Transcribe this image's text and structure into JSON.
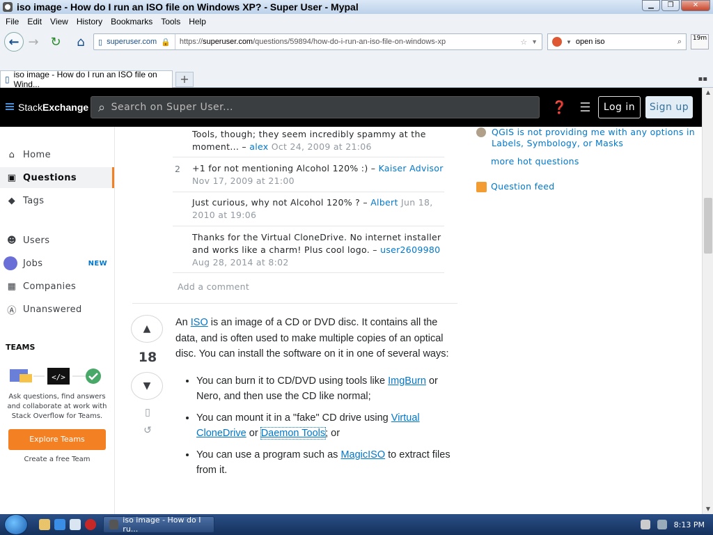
{
  "window": {
    "title": "iso image - How do I run an ISO file on Windows XP? - Super User - Mypal"
  },
  "menu": [
    "File",
    "Edit",
    "View",
    "History",
    "Bookmarks",
    "Tools",
    "Help"
  ],
  "addressbar": {
    "identity": "superuser.com",
    "url_prefix": "https://",
    "url_host": "superuser.com",
    "url_path": "/questions/59894/how-do-i-run-an-iso-file-on-windows-xp"
  },
  "searchbar": {
    "value": "open iso"
  },
  "timebox": {
    "value": "19m"
  },
  "tab": {
    "label": "iso image - How do I run an ISO file on Wind..."
  },
  "site": {
    "logo_prefix": "Stack",
    "logo_suffix": "Exchange",
    "search_placeholder": "Search on Super User...",
    "login": "Log in",
    "signup": "Sign up"
  },
  "sidebar": {
    "items": [
      {
        "label": "Home",
        "icon": "home-icon"
      },
      {
        "label": "Questions",
        "icon": "questions-icon"
      },
      {
        "label": "Tags",
        "icon": "tag-icon"
      },
      {
        "label": "Users",
        "icon": "users-icon"
      },
      {
        "label": "Jobs",
        "icon": "jobs-icon",
        "badge": "NEW"
      },
      {
        "label": "Companies",
        "icon": "companies-icon"
      },
      {
        "label": "Unanswered",
        "icon": "unanswered-icon"
      }
    ],
    "teams_heading": "TEAMS",
    "teams_text": "Ask questions, find answers and collaborate at work with Stack Overflow for Teams.",
    "explore_button": "Explore Teams",
    "create_team": "Create a free Team"
  },
  "comments": [
    {
      "score": "",
      "text": "Tools, though; they seem incredibly spammy at the moment... – ",
      "user": "alex",
      "date": "Oct 24, 2009 at 21:06"
    },
    {
      "score": "2",
      "text": "+1 for not mentioning Alcohol 120% :) – ",
      "user": "Kaiser Advisor",
      "date": "Nov 17, 2009 at 21:00"
    },
    {
      "score": "",
      "text": "Just curious, why not Alcohol 120% ? – ",
      "user": "Albert",
      "date": "Jun 18, 2010 at 19:06"
    },
    {
      "score": "",
      "text": "Thanks for the Virtual CloneDrive. No internet installer and works like a charm! Plus cool logo. – ",
      "user": "user2609980",
      "date": "Aug 28, 2014 at 8:02"
    }
  ],
  "add_comment": "Add a comment",
  "answer": {
    "votes": "18",
    "p1_a": "An ",
    "p1_link": "ISO",
    "p1_b": " is an image of a CD or DVD disc. It contains all the data, and is often used to make multiple copies of an optical disc. You can install the software on it in one of several ways:",
    "li1_a": "You can burn it to CD/DVD using tools like ",
    "li1_link": "ImgBurn",
    "li1_b": " or Nero, and then use the CD like normal;",
    "li2_a": "You can mount it in a \"fake\" CD drive using ",
    "li2_link1": "Virtual CloneDrive",
    "li2_mid": " or ",
    "li2_link2": "Daemon Tools",
    "li2_b": "; or",
    "li3_a": "You can use a program such as ",
    "li3_link": "MagicISO",
    "li3_b": " to extract files from it."
  },
  "rightcol": {
    "hot_question": "QGIS is not providing me with any options in Labels, Symbology, or Masks",
    "more_hot": "more hot questions",
    "feed": "Question feed"
  },
  "taskbar": {
    "window_button": "iso image - How do I ru...",
    "clock": "8:13 PM"
  },
  "colors": {
    "accent": "#f48024",
    "link": "#0077cc",
    "topbar": "#000000"
  }
}
